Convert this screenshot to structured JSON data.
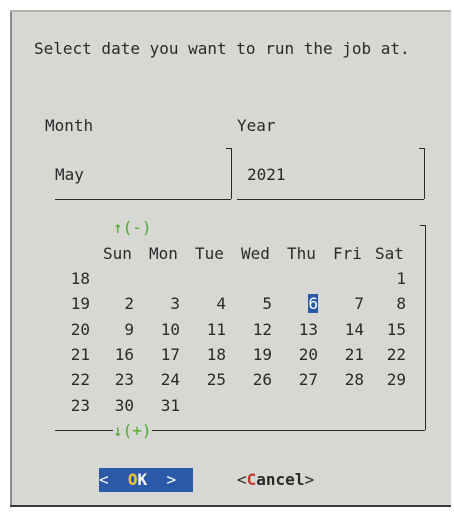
{
  "prompt": "Select date you want to run the job at.",
  "month": {
    "label": "Month",
    "value": "May"
  },
  "year": {
    "label": "Year",
    "value": "2021"
  },
  "calendar": {
    "nav_prev": "↑(-)",
    "nav_next": "↓(+)",
    "weekdays": [
      "Sun",
      "Mon",
      "Tue",
      "Wed",
      "Thu",
      "Fri",
      "Sat"
    ],
    "weeks": [
      {
        "week": "18",
        "days": [
          "",
          "",
          "",
          "",
          "",
          "",
          "1"
        ]
      },
      {
        "week": "19",
        "days": [
          "2",
          "3",
          "4",
          "5",
          "6",
          "7",
          "8"
        ]
      },
      {
        "week": "20",
        "days": [
          "9",
          "10",
          "11",
          "12",
          "13",
          "14",
          "15"
        ]
      },
      {
        "week": "21",
        "days": [
          "16",
          "17",
          "18",
          "19",
          "20",
          "21",
          "22"
        ]
      },
      {
        "week": "22",
        "days": [
          "23",
          "24",
          "25",
          "26",
          "27",
          "28",
          "29"
        ]
      },
      {
        "week": "23",
        "days": [
          "30",
          "31",
          "",
          "",
          "",
          "",
          ""
        ]
      }
    ],
    "selected_day": "6"
  },
  "buttons": {
    "ok": {
      "left": "<  ",
      "hot": "O",
      "rest": "K",
      "right": "  >"
    },
    "cancel": {
      "left": "<",
      "hot": "C",
      "rest": "ancel",
      "right": ">"
    }
  },
  "colors": {
    "background": "#d7d8d3",
    "accent": "#2b5aa8",
    "hotkey_ok": "#f3c52e",
    "hotkey_cancel": "#c33a2e",
    "nav": "#4caa2a"
  }
}
